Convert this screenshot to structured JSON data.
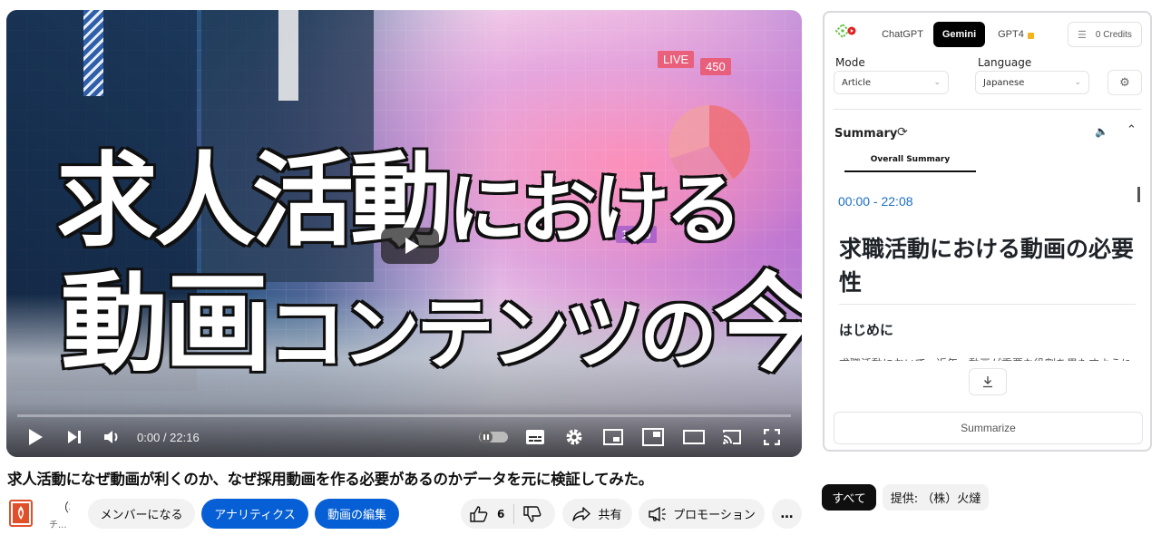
{
  "video": {
    "thumbnail_line1_big": "求人活動",
    "thumbnail_line1_small": "における",
    "thumbnail_line2_big": "動画",
    "thumbnail_line2_small": "コンテンツの",
    "thumbnail_line2_end": "今",
    "badge_live": "LIVE",
    "badge_views": "450",
    "badge_time": "10:30",
    "current_time": "0:00",
    "duration": "22:16",
    "time_display": "0:00 / 22:16",
    "progress": 0,
    "controls": {
      "play_icon": "play-icon",
      "next_icon": "next-icon",
      "volume_icon": "volume-icon",
      "autoplay_toggle": "autoplay-toggle",
      "subtitles_icon": "subtitles-icon",
      "settings_icon": "settings-icon",
      "miniplayer_icon": "miniplayer-icon",
      "pip_icon": "pip-icon",
      "theater_icon": "theater-icon",
      "cast_icon": "cast-icon",
      "fullscreen_icon": "fullscreen-icon"
    }
  },
  "panel": {
    "model_tabs": [
      {
        "label": "ChatGPT",
        "active": false,
        "locked": false
      },
      {
        "label": "Gemini",
        "active": true,
        "locked": false
      },
      {
        "label": "GPT4",
        "active": false,
        "locked": true
      }
    ],
    "credits_label": "0 Credits",
    "mode_label": "Mode",
    "mode_value": "Article",
    "language_label": "Language",
    "language_value": "Japanese",
    "summary_title": "Summary",
    "sub_tab": "Overall Summary",
    "timestamp": "00:00 - 22:08",
    "article_heading": "求職活動における動画の必要性",
    "article_subheading": "はじめに",
    "article_cut_text": "求職活動において、近年、動画が重要な役割を果たすようになってきました。",
    "summarize_button": "Summarize"
  },
  "below": {
    "video_title": "求人活動になぜ動画が利くのか、なぜ採用動画を作る必要があるのかデータを元に検証してみた。",
    "channel_name": "（株）火燵",
    "channel_subs": "チ...",
    "member_button": "メンバーになる",
    "analytics_button": "アナリティクス",
    "edit_button": "動画の編集",
    "like_count": "6",
    "share_button": "共有",
    "promotion_button": "プロモーション",
    "more_button": "…"
  },
  "chips": [
    {
      "label": "すべて",
      "active": true
    },
    {
      "label": "提供: （株）火燵",
      "active": false
    }
  ],
  "colors": {
    "accent_blue": "#065fd4",
    "timestamp_blue": "#1a6ec9",
    "logo_green": "#5cbf3a",
    "logo_red": "#e02020"
  }
}
